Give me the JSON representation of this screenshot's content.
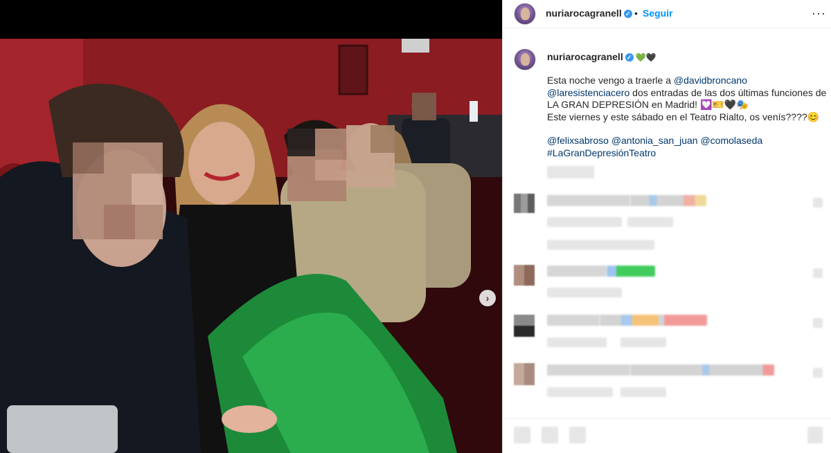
{
  "header": {
    "username": "nuriarocagranell",
    "verified_mark": "✓",
    "separator": "•",
    "follow_label": "Seguir",
    "more_label": "···"
  },
  "caption": {
    "username": "nuriarocagranell",
    "verified_mark": "✓",
    "emoji": "💚🖤",
    "line1_pre": "Esta noche vengo a traerle a ",
    "mention_broncano": "@davidbroncano",
    "mention_resistencia": "@laresistenciacero",
    "line2_post": " dos entradas de las dos últimas funciones de LA GRAN DEPRESIÓN en Madrid! 💟🎫🖤🎭",
    "line3": "Este viernes y este sábado en el Teatro Rialto, os venís????😊",
    "mention_felix": "@felixsabroso",
    "mention_antonia": "@antonia_san_juan",
    "mention_comola": "@comolaseda",
    "hashtag": "#LaGranDepresiónTeatro"
  },
  "photo": {
    "next_arrow": "›",
    "arrow_icon": "chevron-right-icon"
  },
  "colors": {
    "accent": "#0095f6",
    "mention": "#00376b",
    "verified": "#3897f0",
    "text": "#262626"
  }
}
